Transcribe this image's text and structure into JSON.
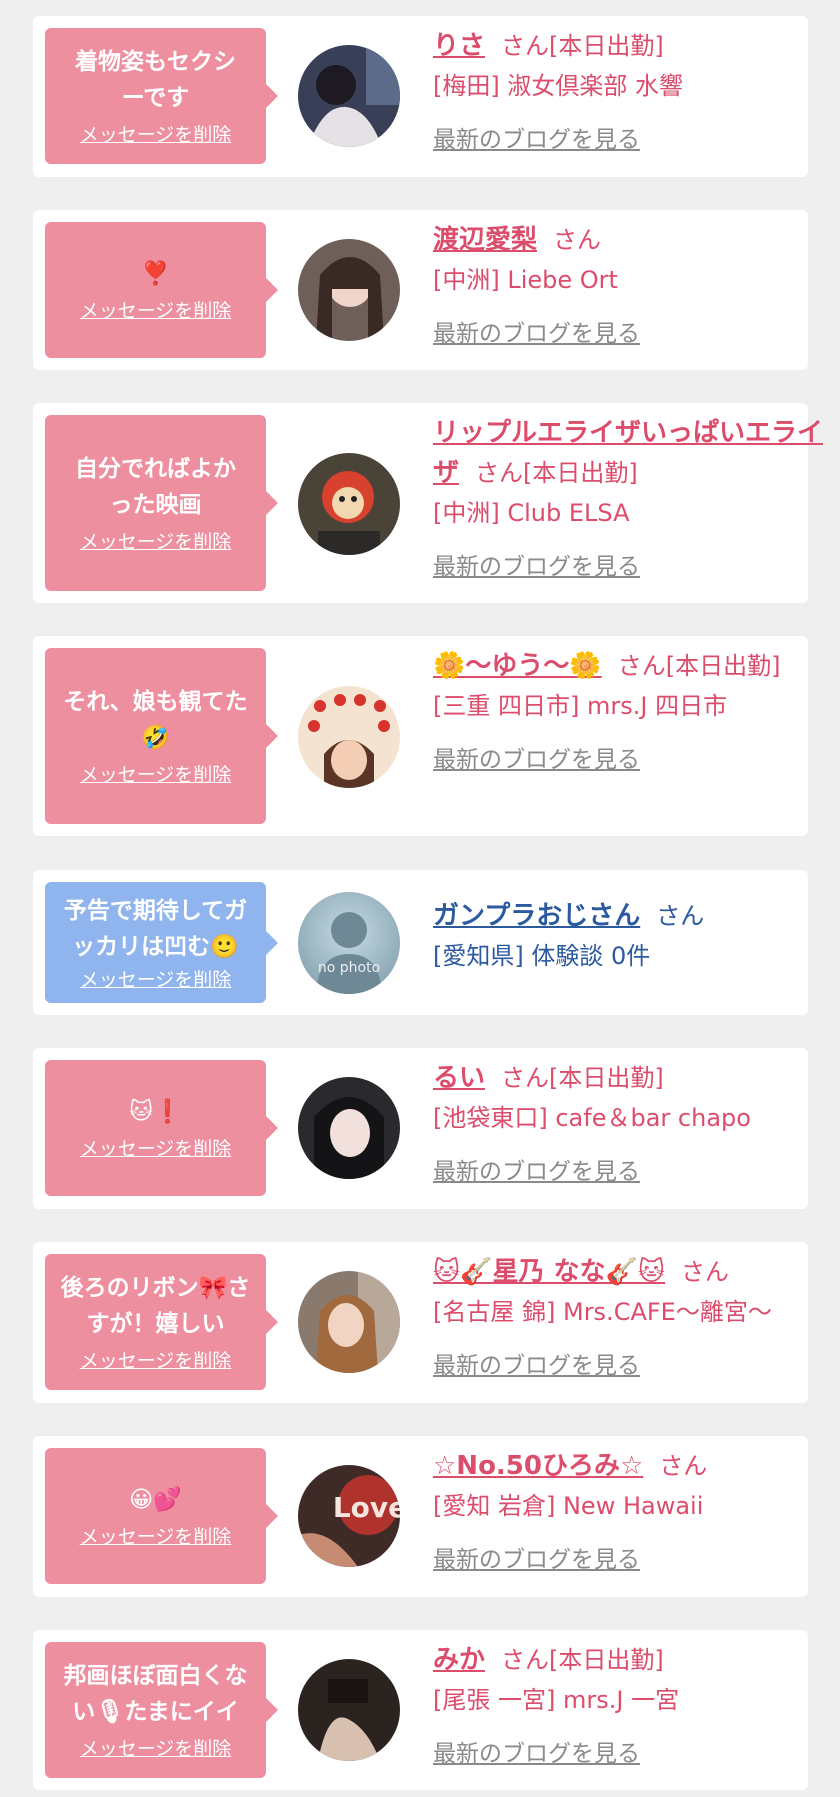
{
  "colors": {
    "pink_bubble": "#ee8fa0",
    "blue_bubble": "#8fb4ee",
    "pink_text": "#dc4d6c",
    "blue_text": "#2c5aa0",
    "link_gray": "#8a8a8a",
    "page_bg": "#efefef"
  },
  "entries": [
    {
      "message": "着物姿もセクシーです",
      "delete_label": "メッセージを削除",
      "name": "りさ",
      "honorific": "さん",
      "status": "[本日出勤]",
      "shop": "[梅田] 淑女倶楽部 水響",
      "blog_link": "最新のブログを見る",
      "theme": "pink"
    },
    {
      "message": "❣️",
      "delete_label": "メッセージを削除",
      "name": "渡辺愛梨",
      "honorific": "さん",
      "status": "",
      "shop": "[中洲] Liebe Ort",
      "blog_link": "最新のブログを見る",
      "theme": "pink"
    },
    {
      "message": "自分でればよかった映画",
      "delete_label": "メッセージを削除",
      "name": "リップルエライザいっぱいエライザ",
      "honorific": "さん",
      "status": "[本日出勤]",
      "shop": "[中洲] Club ELSA",
      "blog_link": "最新のブログを見る",
      "theme": "pink"
    },
    {
      "message": "それ、娘も観てた🤣",
      "delete_label": "メッセージを削除",
      "name": "🌼〜ゆう〜🌼",
      "honorific": "さん",
      "status": "[本日出勤]",
      "shop": "[三重 四日市] mrs.J 四日市",
      "blog_link": "最新のブログを見る",
      "theme": "pink"
    },
    {
      "message": "予告で期待してガッカリは凹む🙂",
      "delete_label": "メッセージを削除",
      "name": "ガンプラおじさん",
      "honorific": "さん",
      "status": "",
      "shop": "[愛知県] 体験談 0件",
      "blog_link": "",
      "theme": "blue",
      "avatar_text": "no photo"
    },
    {
      "message": "🐱❗",
      "delete_label": "メッセージを削除",
      "name": "るい",
      "honorific": "さん",
      "status": "[本日出勤]",
      "shop": "[池袋東口] cafe＆bar chapo",
      "blog_link": "最新のブログを見る",
      "theme": "pink"
    },
    {
      "message": "後ろのリボン🎀さすが！嬉しい",
      "delete_label": "メッセージを削除",
      "name": "🐱🎸星乃 なな🎸🐱",
      "honorific": "さん",
      "status": "",
      "shop": "[名古屋 錦] Mrs.CAFE〜離宮〜",
      "blog_link": "最新のブログを見る",
      "theme": "pink"
    },
    {
      "message": "😀💕",
      "delete_label": "メッセージを削除",
      "name": "☆No.50ひろみ☆",
      "honorific": "さん",
      "status": "",
      "shop": "[愛知 岩倉] New Hawaii",
      "blog_link": "最新のブログを見る",
      "theme": "pink",
      "avatar_text": "Love"
    },
    {
      "message": "邦画ほぼ面白くない🎙たまにイイ",
      "delete_label": "メッセージを削除",
      "name": "みか",
      "honorific": "さん",
      "status": "[本日出勤]",
      "shop": "[尾張 一宮] mrs.J 一宮",
      "blog_link": "最新のブログを見る",
      "theme": "pink"
    }
  ]
}
